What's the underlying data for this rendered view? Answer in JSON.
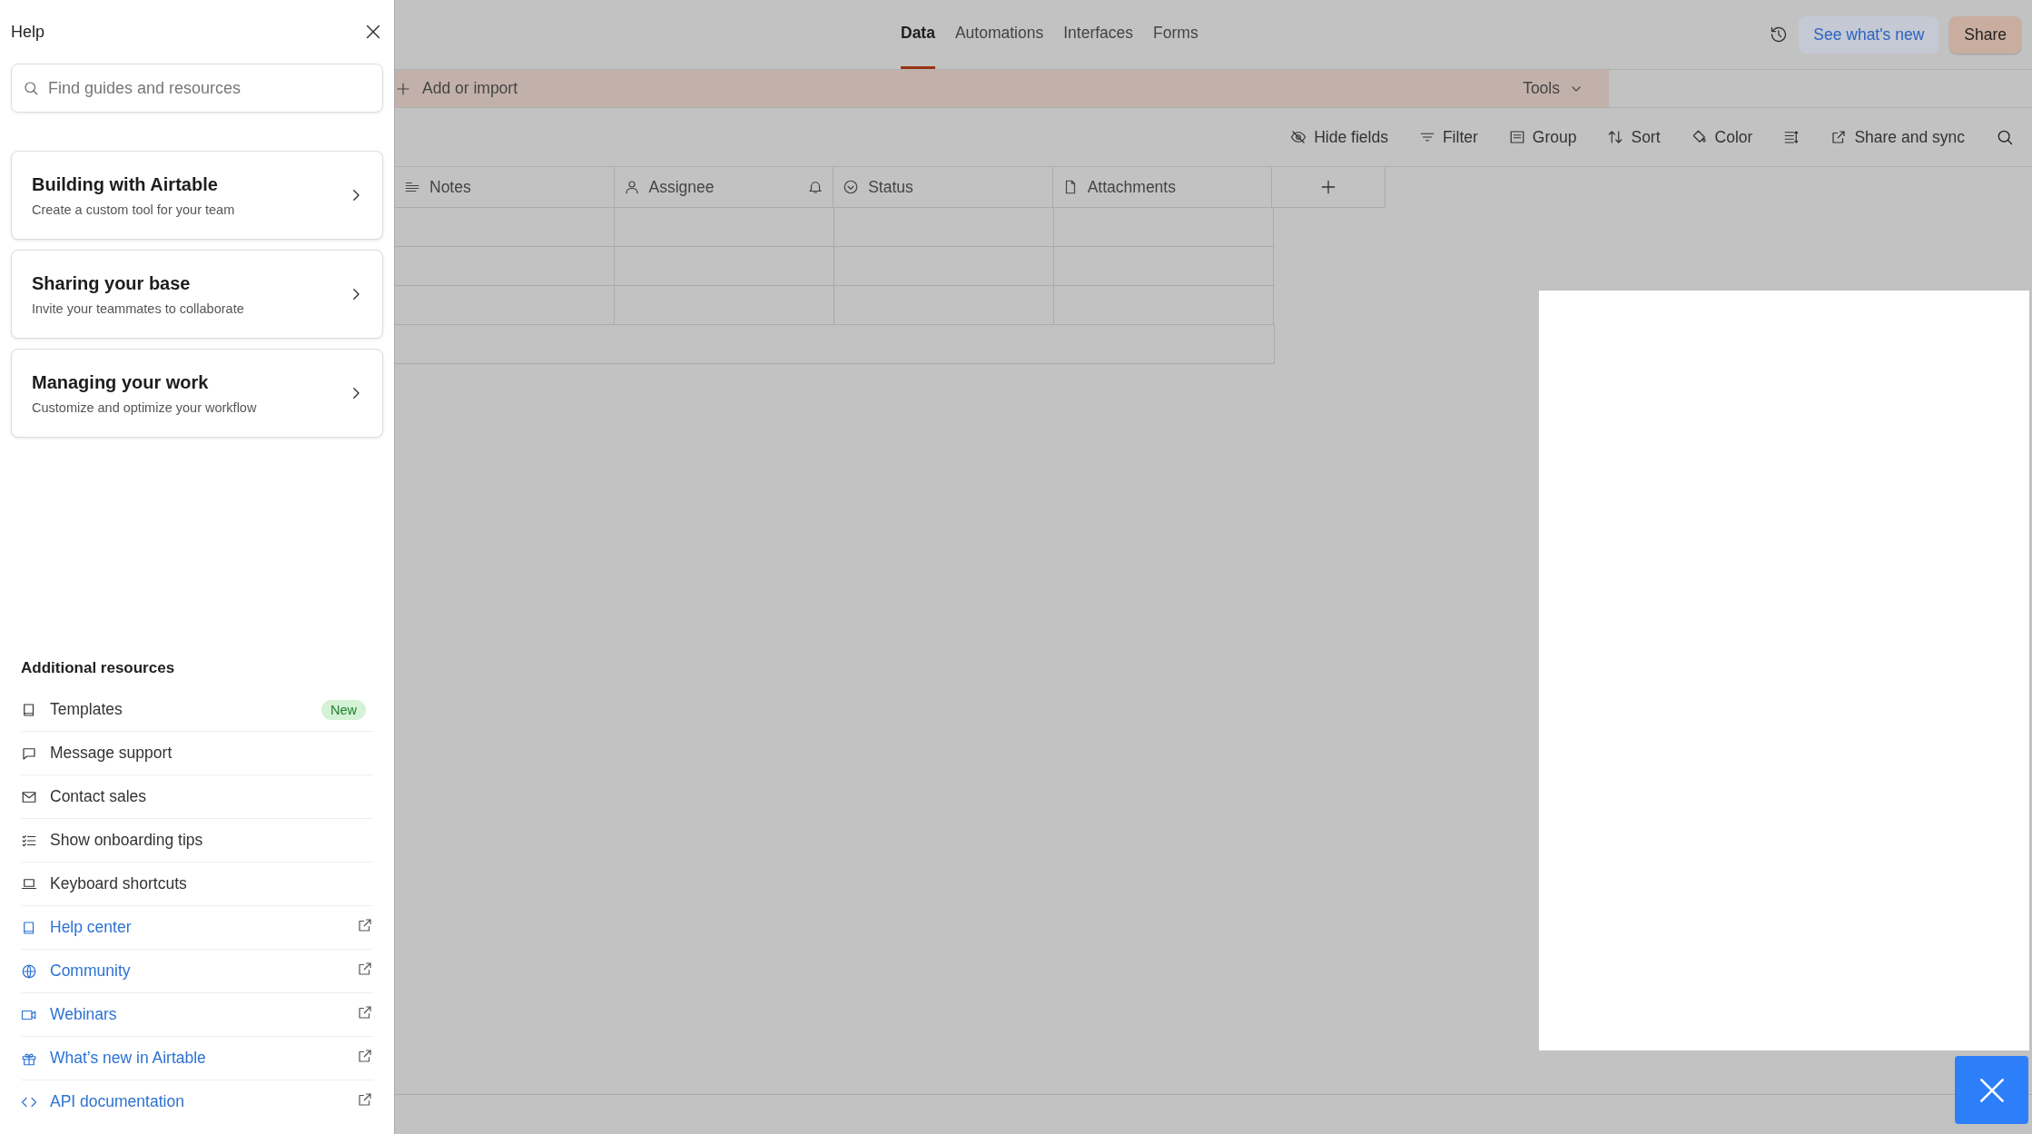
{
  "help_panel": {
    "title": "Help",
    "search": {
      "placeholder": "Find guides and resources"
    },
    "guides": [
      {
        "title": "Building with Airtable",
        "subtitle": "Create a custom tool for your team"
      },
      {
        "title": "Sharing your base",
        "subtitle": "Invite your teammates to collaborate"
      },
      {
        "title": "Managing your work",
        "subtitle": "Customize and optimize your workflow"
      }
    ],
    "resources_heading": "Additional resources",
    "resources": [
      {
        "label": "Templates",
        "kind": "internal",
        "badge": "New"
      },
      {
        "label": "Message support",
        "kind": "internal"
      },
      {
        "label": "Contact sales",
        "kind": "internal"
      },
      {
        "label": "Show onboarding tips",
        "kind": "internal"
      },
      {
        "label": "Keyboard shortcuts",
        "kind": "internal"
      },
      {
        "label": "Help center",
        "kind": "external"
      },
      {
        "label": "Community",
        "kind": "external"
      },
      {
        "label": "Webinars",
        "kind": "external"
      },
      {
        "label": "What’s new in Airtable",
        "kind": "external"
      },
      {
        "label": "API documentation",
        "kind": "external"
      }
    ]
  },
  "tabs": [
    {
      "label": "Data",
      "selected": true
    },
    {
      "label": "Automations",
      "selected": false
    },
    {
      "label": "Interfaces",
      "selected": false
    },
    {
      "label": "Forms",
      "selected": false
    }
  ],
  "header_buttons": {
    "whats_new": "See what's new",
    "share": "Share"
  },
  "table_bar": {
    "add": "Add or import",
    "tools": "Tools"
  },
  "toolbar": [
    {
      "kind": "text",
      "label": "Hide fields"
    },
    {
      "kind": "text",
      "label": "Filter"
    },
    {
      "kind": "text",
      "label": "Group"
    },
    {
      "kind": "text",
      "label": "Sort"
    },
    {
      "kind": "text",
      "label": "Color"
    },
    {
      "kind": "icon"
    },
    {
      "kind": "text",
      "label": "Share and sync"
    }
  ],
  "columns": [
    "Notes",
    "Assignee",
    "Status",
    "Attachments"
  ]
}
